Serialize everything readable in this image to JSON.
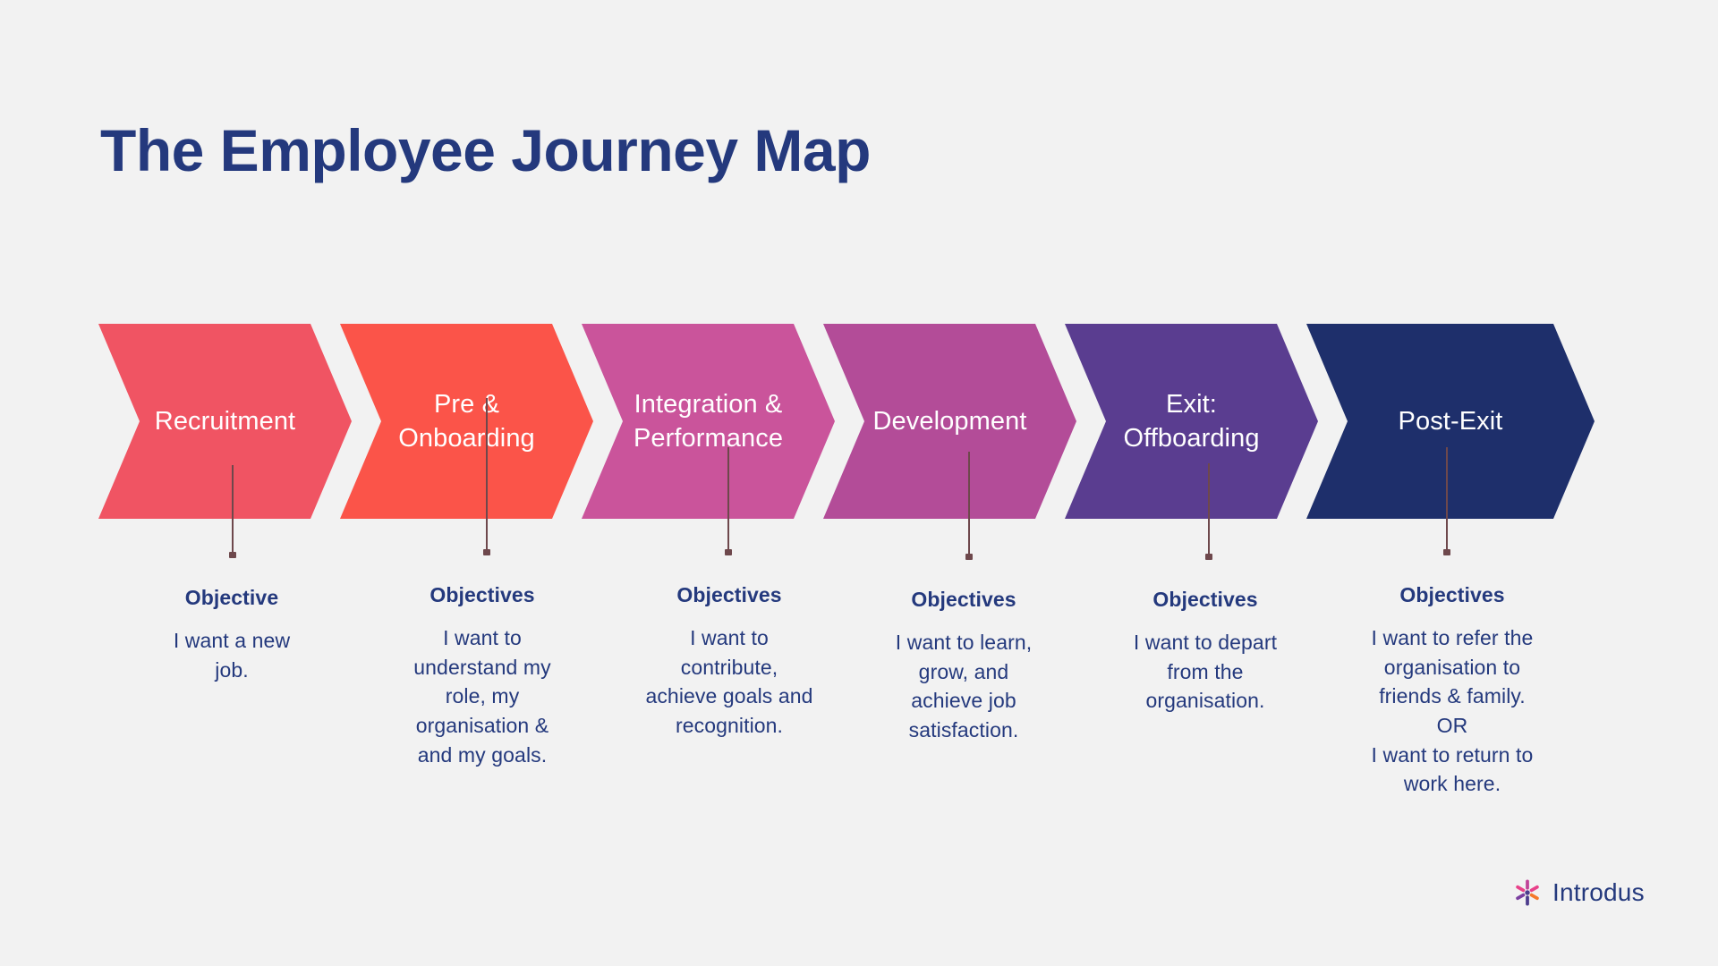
{
  "page": {
    "title": "The Employee Journey Map",
    "background_color": "#F2F2F2",
    "navy": "#24397D",
    "connector_color": "#6E484C"
  },
  "stages": [
    {
      "id": "recruitment",
      "label": "Recruitment",
      "color": "#F05463",
      "objective_heading": "Objective",
      "objective_body": "I want a new\njob."
    },
    {
      "id": "pre-onboarding",
      "label": "Pre &\nOnboarding",
      "color": "#FB5449",
      "objective_heading": "Objectives",
      "objective_body": "I want to\nunderstand my\nrole, my\norganisation &\nand my goals."
    },
    {
      "id": "integration-performance",
      "label": "Integration &\nPerformance",
      "color": "#CA549B",
      "objective_heading": "Objectives",
      "objective_body": "I want to\ncontribute,\nachieve goals and\nrecognition."
    },
    {
      "id": "development",
      "label": "Development",
      "color": "#B34C98",
      "objective_heading": "Objectives",
      "objective_body": "I want to learn,\ngrow, and\nachieve job\nsatisfaction."
    },
    {
      "id": "exit-offboarding",
      "label": "Exit:\nOffboarding",
      "color": "#5A3D90",
      "objective_heading": "Objectives",
      "objective_body": "I want to depart\nfrom the\norganisation."
    },
    {
      "id": "post-exit",
      "label": "Post-Exit",
      "color": "#1E2F6B",
      "objective_heading": "Objectives",
      "objective_body": "I want to refer the\norganisation to\nfriends & family.\nOR\nI want to return to\nwork here."
    }
  ],
  "logo": {
    "text": "Introdus",
    "mark_name": "introdus-asterisk-logo",
    "petal_colors": [
      "#E8428A",
      "#7B3FA0",
      "#F4792B",
      "#C04398",
      "#4C3C8C",
      "#E8428A"
    ]
  }
}
